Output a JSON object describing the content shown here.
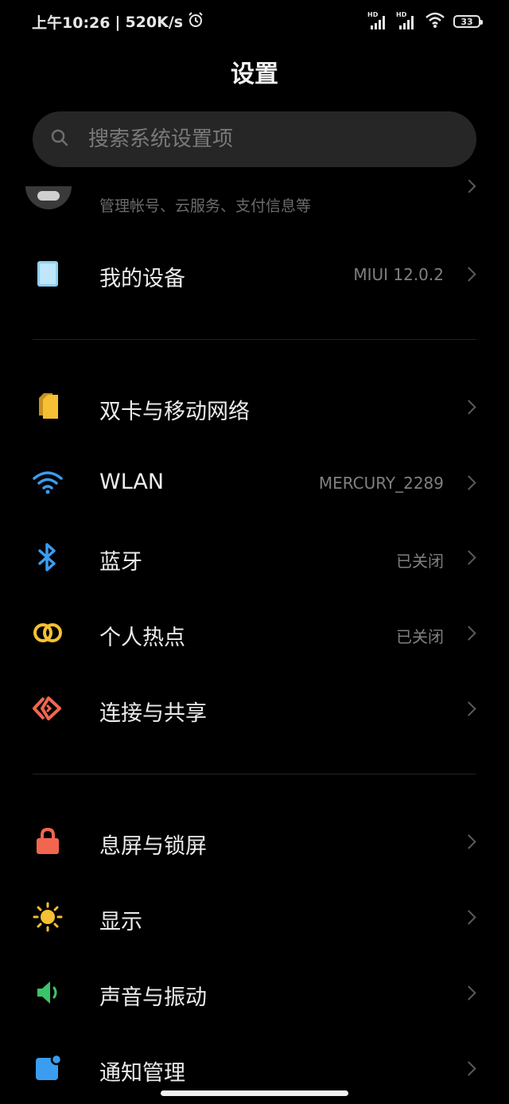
{
  "status_bar": {
    "time": "上午10:26",
    "separator": "|",
    "speed": "520K/s",
    "signal1_label": "HD",
    "signal2_label": "HD",
    "battery": "33"
  },
  "header": {
    "title": "设置"
  },
  "search": {
    "placeholder": "搜索系统设置项"
  },
  "account": {
    "subtitle": "管理帐号、云服务、支付信息等"
  },
  "items": [
    {
      "label": "我的设备",
      "value": "MIUI 12.0.2",
      "icon": "device-icon",
      "color": "#8fd0f2"
    },
    {
      "label": "双卡与移动网络",
      "value": "",
      "icon": "sim-card-icon",
      "color": "#f5c033"
    },
    {
      "label": "WLAN",
      "value": "MERCURY_2289",
      "icon": "wifi-icon",
      "color": "#3a9df0"
    },
    {
      "label": "蓝牙",
      "value": "已关闭",
      "icon": "bluetooth-icon",
      "color": "#3a9df0"
    },
    {
      "label": "个人热点",
      "value": "已关闭",
      "icon": "hotspot-icon",
      "color": "#f5c033"
    },
    {
      "label": "连接与共享",
      "value": "",
      "icon": "connection-share-icon",
      "color": "#f2664f"
    },
    {
      "label": "息屏与锁屏",
      "value": "",
      "icon": "lock-icon",
      "color": "#f2664f"
    },
    {
      "label": "显示",
      "value": "",
      "icon": "brightness-icon",
      "color": "#f5c033"
    },
    {
      "label": "声音与振动",
      "value": "",
      "icon": "speaker-icon",
      "color": "#3cc46a"
    },
    {
      "label": "通知管理",
      "value": "",
      "icon": "notification-icon",
      "color": "#3a9df0"
    }
  ]
}
